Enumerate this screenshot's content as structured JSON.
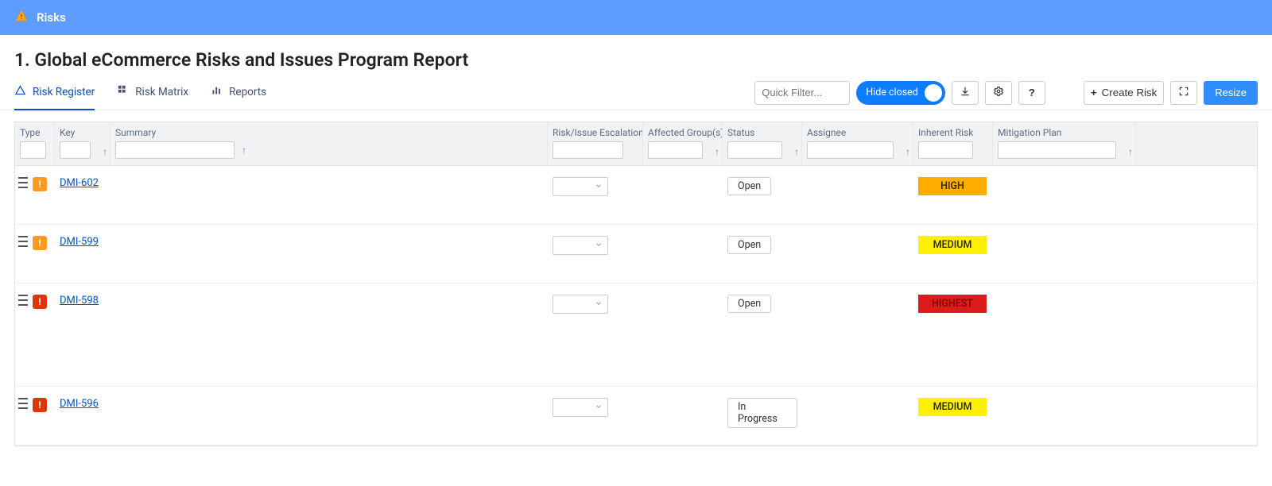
{
  "banner": {
    "title": "Risks"
  },
  "page": {
    "title": "1. Global eCommerce Risks and Issues Program Report"
  },
  "tabs": [
    {
      "id": "register",
      "label": "Risk Register",
      "active": true
    },
    {
      "id": "matrix",
      "label": "Risk Matrix",
      "active": false
    },
    {
      "id": "reports",
      "label": "Reports",
      "active": false
    }
  ],
  "toolbar": {
    "quick_filter_placeholder": "Quick Filter...",
    "hide_closed_label": "Hide closed",
    "create_label": "Create Risk",
    "resize_label": "Resize"
  },
  "columns": {
    "type": "Type",
    "key": "Key",
    "summary": "Summary",
    "escalation": "Risk/Issue Escalation Level",
    "affected": "Affected Group(s)",
    "status": "Status",
    "assignee": "Assignee",
    "inherent": "Inherent Risk",
    "mitigation": "Mitigation Plan"
  },
  "rows": [
    {
      "type_color": "orange",
      "key": "DMI-602",
      "summary": "",
      "escalation": "",
      "affected": "",
      "status": "Open",
      "assignee": "",
      "inherent": "HIGH",
      "mitigation": "",
      "tall": false
    },
    {
      "type_color": "orange",
      "key": "DMI-599",
      "summary": "",
      "escalation": "",
      "affected": "",
      "status": "Open",
      "assignee": "",
      "inherent": "MEDIUM",
      "mitigation": "",
      "tall": false
    },
    {
      "type_color": "red",
      "key": "DMI-598",
      "summary": "",
      "escalation": "",
      "affected": "",
      "status": "Open",
      "assignee": "",
      "inherent": "HIGHEST",
      "mitigation": "",
      "tall": true
    },
    {
      "type_color": "red",
      "key": "DMI-596",
      "summary": "",
      "escalation": "",
      "affected": "",
      "status": "In Progress",
      "assignee": "",
      "inherent": "MEDIUM",
      "mitigation": "",
      "tall": false
    }
  ]
}
